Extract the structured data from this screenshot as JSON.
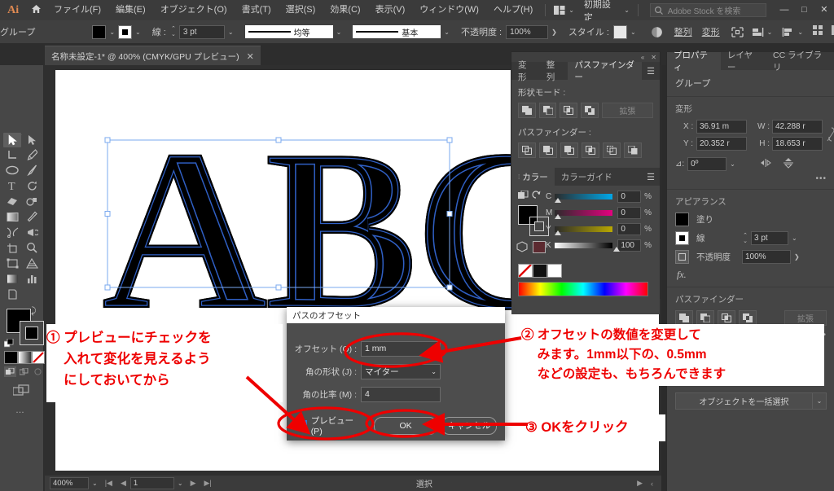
{
  "app": {
    "logo": "Ai",
    "home_icon": "home-icon",
    "menus": [
      "ファイル(F)",
      "編集(E)",
      "オブジェクト(O)",
      "書式(T)",
      "選択(S)",
      "効果(C)",
      "表示(V)",
      "ウィンドウ(W)",
      "ヘルプ(H)"
    ],
    "arrange_icon": "arrange-documents-icon",
    "workspace": "初期設定",
    "search_placeholder": "Adobe Stock を検索",
    "window_buttons": {
      "minimize": "—",
      "maximize": "□",
      "close": "✕"
    }
  },
  "controlbar": {
    "selection_label": "グループ",
    "fill_label": "fill-swatch",
    "stroke_label": "stroke-swatch",
    "stroke_weight_label": "線 :",
    "stroke_weight": "3 pt",
    "stroke_profile": "均等",
    "brush_definition": "基本",
    "opacity_label": "不透明度 :",
    "opacity": "100%",
    "style_label": "スタイル :",
    "recolor_icon": "recolor-artwork-icon",
    "align_button": "整列",
    "transform_button": "変形",
    "icons": [
      "shape-builder-icon",
      "arrange-icon",
      "align-icon",
      "distribute-icon",
      "transform-icon",
      "options-icon"
    ]
  },
  "document_tab": {
    "title": "名称未設定-1* @ 400% (CMYK/GPU プレビュー)",
    "close": "✕"
  },
  "toolbar": {
    "tools_left": [
      {
        "name": "selection-tool",
        "selected": true
      },
      {
        "name": "magic-wand-tool",
        "selected": false
      },
      {
        "name": "ellipse-tool",
        "selected": false
      },
      {
        "name": "type-tool",
        "selected": false
      },
      {
        "name": "eraser-tool",
        "selected": false
      },
      {
        "name": "rectangle-tool",
        "selected": false
      },
      {
        "name": "scissors-tool",
        "selected": false
      },
      {
        "name": "artboard-tool",
        "selected": false
      },
      {
        "name": "free-transform-tool",
        "selected": false
      },
      {
        "name": "gradient-tool",
        "selected": false
      },
      {
        "name": "slice-tool",
        "selected": false
      }
    ],
    "tools_right": [
      {
        "name": "direct-selection-tool"
      },
      {
        "name": "pen-tool"
      },
      {
        "name": "paintbrush-tool"
      },
      {
        "name": "rotate-tool"
      },
      {
        "name": "shape-builder-tool"
      },
      {
        "name": "eyedropper-tool"
      },
      {
        "name": "symbol-sprayer-tool"
      },
      {
        "name": "zoom-tool"
      },
      {
        "name": "perspective-grid-tool"
      },
      {
        "name": "column-graph-tool"
      }
    ],
    "fill_color": "#000000",
    "stroke_color": "#000000",
    "swap_icon": "swap-fill-stroke-icon",
    "default_icon": "default-fill-stroke-icon",
    "color_modes": [
      "color-icon",
      "gradient-icon",
      "none-icon"
    ],
    "draw_modes": [
      "draw-normal-icon",
      "draw-behind-icon",
      "draw-inside-icon"
    ],
    "screen_mode_icon": "screen-mode-icon",
    "more_tools": "…"
  },
  "artwork": {
    "text": "ABC",
    "fill": "#000000",
    "path_color": "#2f5fc4",
    "selection_color": "#7aa8ef"
  },
  "pathfinder_panel": {
    "tabs": [
      "変形",
      "整列",
      "パスファインダー"
    ],
    "active_tab": "パスファインダー",
    "menu_icon": "panel-menu-icon",
    "shape_modes_label": "形状モード :",
    "shape_mode_buttons": [
      "unite-icon",
      "minus-front-icon",
      "intersect-icon",
      "exclude-icon"
    ],
    "expand_button": "拡張",
    "pathfinders_label": "パスファインダー :",
    "pathfinder_buttons": [
      "divide-icon",
      "trim-icon",
      "merge-icon",
      "crop-icon",
      "outline-icon",
      "minus-back-icon"
    ]
  },
  "color_panel": {
    "tabs": [
      "カラー",
      "カラーガイド"
    ],
    "active_tab": "カラー",
    "menu_icon": "panel-menu-icon",
    "sliders": [
      {
        "channel": "C",
        "value": "0",
        "unit": "%",
        "pos": 2,
        "ramp_to": "#00a7e8"
      },
      {
        "channel": "M",
        "value": "0",
        "unit": "%",
        "pos": 2,
        "ramp_to": "#e5007f"
      },
      {
        "channel": "Y",
        "value": "0",
        "unit": "%",
        "pos": 2,
        "ramp_to": "#ffe800"
      },
      {
        "channel": "K",
        "value": "100",
        "unit": "%",
        "pos": 100,
        "ramp_to": "#000000"
      }
    ],
    "swatches": [
      "none-swatch",
      "black-swatch",
      "white-swatch"
    ]
  },
  "properties_panel": {
    "tabs": [
      "プロパティ",
      "レイヤー",
      "CC ライブラリ"
    ],
    "active_tab": "プロパティ",
    "selection_type": "グループ",
    "transform": {
      "heading": "変形",
      "x_label": "X :",
      "x_value": "36.91 m",
      "y_label": "Y :",
      "y_value": "20.352 r",
      "w_label": "W :",
      "w_value": "42.288 r",
      "h_label": "H :",
      "h_value": "18.653 r",
      "angle_label": "angle-icon",
      "angle_value": "0º",
      "link_icon": "unlink-proportions-icon",
      "flip_h_icon": "flip-horizontal-icon",
      "flip_v_icon": "flip-vertical-icon",
      "more": "•••"
    },
    "appearance": {
      "heading": "アピアランス",
      "fill_label": "塗り",
      "stroke_label": "線",
      "stroke_weight": "3 pt",
      "opacity_label": "不透明度",
      "opacity_value": "100%",
      "fx_label": "fx."
    },
    "pathfinder": {
      "heading": "パスファインダー",
      "buttons": [
        "unite-icon",
        "minus-front-icon",
        "intersect-icon",
        "exclude-icon"
      ],
      "expand_button": "拡張",
      "more": "•••"
    },
    "select_all_button": "オブジェクトを一括選択"
  },
  "dialog": {
    "title": "パスのオフセット",
    "offset_label": "オフセット (O) :",
    "offset_value": "1 mm",
    "joins_label": "角の形状 (J) :",
    "joins_value": "マイター",
    "miter_label": "角の比率 (M) :",
    "miter_value": "4",
    "preview_label": "プレビュー (P)",
    "preview_checked": "✔",
    "ok_button": "OK",
    "cancel_button": "キャンセル"
  },
  "statusbar": {
    "zoom": "400%",
    "page": "1",
    "tool": "選択",
    "first_icon": "first-page-icon",
    "prev_icon": "prev-page-icon",
    "next_icon": "next-page-icon",
    "last_icon": "last-page-icon",
    "play_icon": "play-icon",
    "chev_icon": "chevron-left-icon"
  },
  "annotations": {
    "color": "#ee0000",
    "note1": [
      "① プレビューにチェックを",
      "　 入れて変化を見えるよう",
      "　 にしておいてから"
    ],
    "note2": [
      "② オフセットの数値を変更して",
      "　 みます。1mm以下の、0.5mm",
      "　 などの設定も、もちろんできます"
    ],
    "note3": [
      "③ OKをクリック"
    ]
  }
}
